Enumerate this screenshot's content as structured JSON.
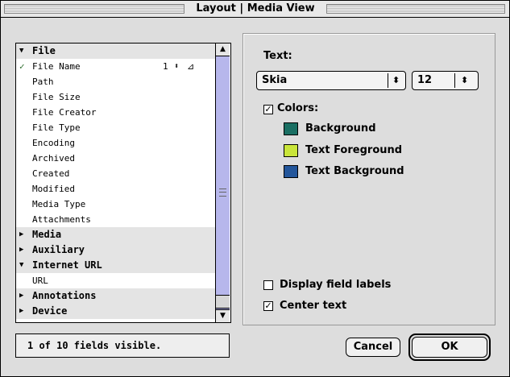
{
  "window": {
    "title": "Layout | Media View"
  },
  "list": {
    "rows": [
      {
        "type": "group",
        "label": "File",
        "expanded": true
      },
      {
        "type": "field",
        "label": "File Name",
        "checked": true,
        "value": "1"
      },
      {
        "type": "field",
        "label": "Path"
      },
      {
        "type": "field",
        "label": "File Size"
      },
      {
        "type": "field",
        "label": "File Creator"
      },
      {
        "type": "field",
        "label": "File Type"
      },
      {
        "type": "field",
        "label": "Encoding"
      },
      {
        "type": "field",
        "label": "Archived"
      },
      {
        "type": "field",
        "label": "Created"
      },
      {
        "type": "field",
        "label": "Modified"
      },
      {
        "type": "field",
        "label": "Media Type"
      },
      {
        "type": "field",
        "label": "Attachments"
      },
      {
        "type": "group",
        "label": "Media",
        "expanded": false
      },
      {
        "type": "group",
        "label": "Auxiliary",
        "expanded": false
      },
      {
        "type": "group",
        "label": "Internet URL",
        "expanded": true
      },
      {
        "type": "field",
        "label": "URL"
      },
      {
        "type": "group",
        "label": "Annotations",
        "expanded": false
      },
      {
        "type": "group",
        "label": "Device",
        "expanded": false
      }
    ]
  },
  "status": {
    "text": "1 of 10 fields visible."
  },
  "panel": {
    "text_label": "Text:",
    "font": {
      "value": "Skia"
    },
    "size": {
      "value": "12"
    },
    "colors_label": "Colors:",
    "colors_checked": true,
    "colors": [
      {
        "label": "Background",
        "color": "#1a6f63"
      },
      {
        "label": "Text Foreground",
        "color": "#c9e53a"
      },
      {
        "label": "Text Background",
        "color": "#23569b"
      }
    ],
    "display_field_labels": {
      "label": "Display field labels",
      "checked": false
    },
    "center_text": {
      "label": "Center text",
      "checked": true
    }
  },
  "buttons": {
    "cancel": "Cancel",
    "ok": "OK"
  }
}
